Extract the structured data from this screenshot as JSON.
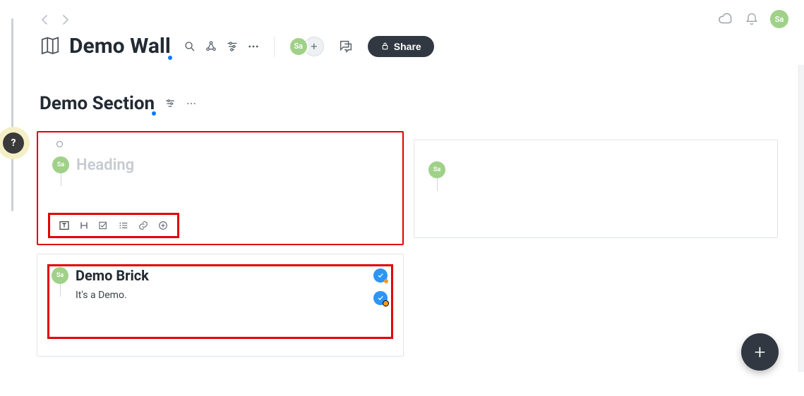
{
  "user": {
    "initials": "Sa"
  },
  "header": {
    "title": "Demo Wall",
    "share_label": "Share"
  },
  "section": {
    "title": "Demo Section"
  },
  "cards": {
    "a": {
      "heading_placeholder": "Heading",
      "author": "Sa"
    },
    "b": {
      "author": "Sa"
    },
    "c": {
      "title": "Demo Brick",
      "body": "It's a Demo.",
      "author": "Sa"
    }
  },
  "help_label": "?",
  "fab_label": "+",
  "add_label": "+"
}
